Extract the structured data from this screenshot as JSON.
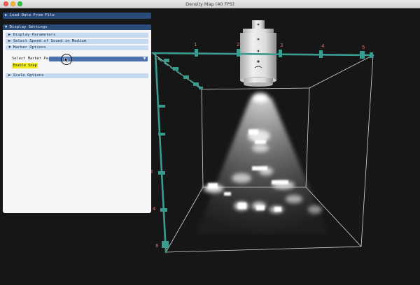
{
  "window": {
    "title": "Density Map (40 FPS)"
  },
  "load_panel": {
    "label": "▶ Load Data From File"
  },
  "display_settings": {
    "label": "▼ Display Settings",
    "sections": [
      {
        "label": "▶ Display Parameters"
      },
      {
        "label": "▶ Select Speed of Sound in Medium"
      },
      {
        "label": "▼ Marker Options"
      },
      {
        "label": "▶ Scale Options"
      }
    ],
    "marker_pair_label": "Select Marker Pair",
    "combo_arrow": "▼",
    "snap_button": "Enable Snap"
  },
  "scene": {
    "axis_color": "#3a9c8e",
    "box_line_color": "#d9d9d9",
    "horizontal_ticks": [
      "1",
      "2",
      "3",
      "4",
      "5"
    ],
    "vertical_ticks": [
      "3",
      "4",
      "8"
    ],
    "tick_label_color": "#e06a6a",
    "sonar_body_color": "#d8d8d8"
  }
}
